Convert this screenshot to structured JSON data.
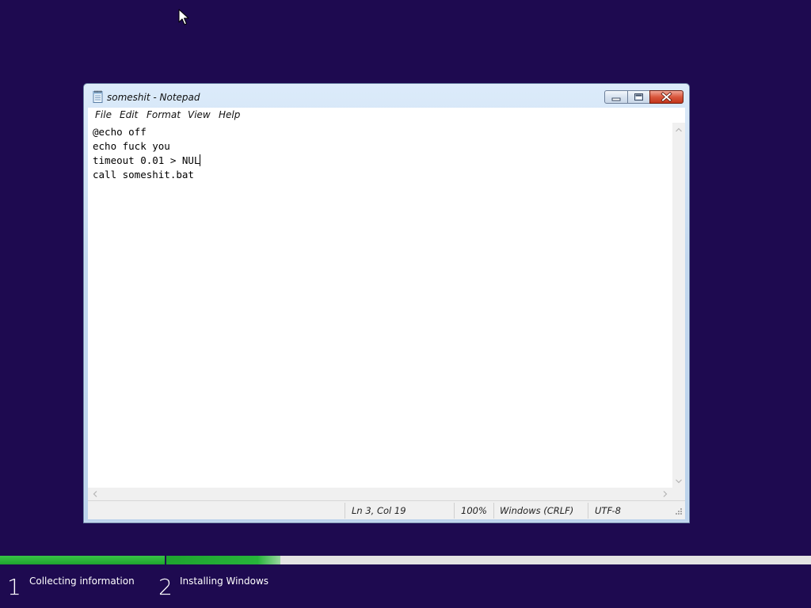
{
  "window": {
    "title": "someshit - Notepad",
    "app_icon": "notepad-icon",
    "caption_buttons": [
      "minimize-icon",
      "maximize-icon",
      "close-icon"
    ]
  },
  "menu": {
    "items": [
      {
        "label": "File"
      },
      {
        "label": "Edit"
      },
      {
        "label": "Format"
      },
      {
        "label": "View"
      },
      {
        "label": "Help"
      }
    ]
  },
  "editor": {
    "lines": [
      "@echo off",
      "echo fuck you",
      "timeout 0.01 > NUL",
      "call someshit.bat"
    ],
    "caret_line": 3,
    "caret_col": 19
  },
  "statusbar": {
    "position": "Ln 3, Col 19",
    "zoom": "100%",
    "line_ending": "Windows (CRLF)",
    "encoding": "UTF-8"
  },
  "setup": {
    "progress_fraction": 0.345,
    "steps": [
      {
        "number": "1",
        "label": "Collecting information"
      },
      {
        "number": "2",
        "label": "Installing Windows"
      }
    ]
  },
  "colors": {
    "desktop_background": "#1e0a50",
    "progress_green": "#1fa42f",
    "progress_track": "#e4e4e4",
    "text_white": "#ffffff"
  },
  "icons": {
    "cursor": "mouse-pointer-icon",
    "resize_grip": "resize-grip-icon",
    "scroll_arrows": [
      "scroll-up-icon",
      "scroll-down-icon",
      "scroll-left-icon",
      "scroll-right-icon"
    ]
  }
}
